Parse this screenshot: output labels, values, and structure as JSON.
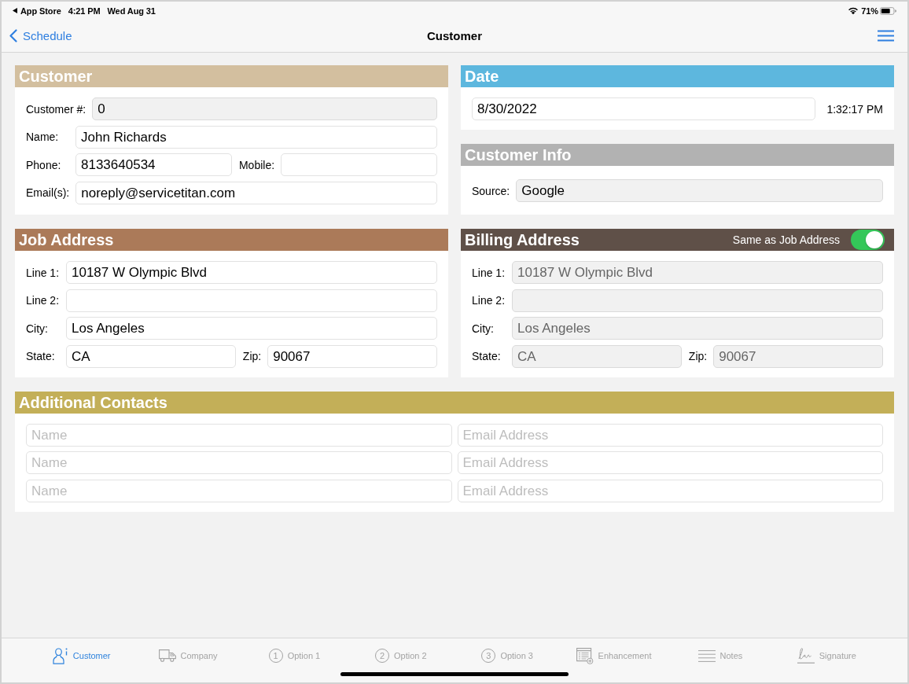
{
  "status_bar": {
    "back_app": "App Store",
    "time": "4:21 PM",
    "date": "Wed Aug 31",
    "battery": "71%"
  },
  "nav_bar": {
    "back": "Schedule",
    "title": "Customer"
  },
  "customer": {
    "title": "Customer",
    "rows": [
      [
        {
          "label": "Customer #:",
          "value": "0",
          "readonly": true
        }
      ],
      [
        {
          "label": "Name:",
          "value": "John Richards",
          "readonly": false
        }
      ],
      [
        {
          "label": "Phone:",
          "value": "8133640534",
          "readonly": false
        },
        {
          "label": "Mobile:",
          "readonly": false
        }
      ],
      [
        {
          "label": "Email(s):",
          "value": "noreply@servicetitan.com",
          "readonly": false
        }
      ]
    ]
  },
  "date": {
    "title": "Date",
    "value": "8/30/2022",
    "time": "1:32:17 PM"
  },
  "customer_info": {
    "title": "Customer Info",
    "rows": [
      [
        {
          "label": "Source:",
          "value": "Google",
          "readonly": true
        }
      ]
    ]
  },
  "job_address": {
    "title": "Job Address",
    "rows": [
      [
        {
          "label": "Line 1:",
          "value": "10187 W Olympic Blvd",
          "readonly": false
        }
      ],
      [
        {
          "label": "Line 2:",
          "readonly": false
        }
      ],
      [
        {
          "label": "City:",
          "value": "Los Angeles",
          "readonly": false
        }
      ],
      [
        {
          "label": "State:",
          "value": "CA",
          "readonly": false
        },
        {
          "label": "Zip:",
          "value": "90067",
          "readonly": false
        }
      ]
    ]
  },
  "billing_address": {
    "title": "Billing Address",
    "toggle": {
      "label": "Same as Job Address",
      "on": true
    },
    "rows": [
      [
        {
          "label": "Line 1:",
          "value": "10187 W Olympic Blvd",
          "readonly": true
        }
      ],
      [
        {
          "label": "Line 2:",
          "readonly": true
        }
      ],
      [
        {
          "label": "City:",
          "value": "Los Angeles",
          "readonly": true
        }
      ],
      [
        {
          "label": "State:",
          "value": "CA",
          "readonly": true
        },
        {
          "label": "Zip:",
          "value": "90067",
          "readonly": true
        }
      ]
    ]
  },
  "additional_contacts": {
    "title": "Additional Contacts",
    "rows": [
      [
        {
          "placeholder": "Name"
        },
        {
          "placeholder": "Email Address"
        }
      ],
      [
        {
          "placeholder": "Name"
        },
        {
          "placeholder": "Email Address"
        }
      ],
      [
        {
          "placeholder": "Name"
        },
        {
          "placeholder": "Email Address"
        }
      ]
    ]
  },
  "tab_bar": [
    {
      "label": "Customer",
      "kind": "person",
      "selected": true
    },
    {
      "label": "Company",
      "kind": "truck",
      "selected": false
    },
    {
      "label": "Option 1",
      "kind": "number",
      "number": "1",
      "selected": false
    },
    {
      "label": "Option 2",
      "kind": "number",
      "number": "2",
      "selected": false
    },
    {
      "label": "Option 3",
      "kind": "number",
      "number": "3",
      "selected": false
    },
    {
      "label": "Enhancement",
      "kind": "document",
      "selected": false
    },
    {
      "label": "Notes",
      "kind": "lines",
      "selected": false
    },
    {
      "label": "Signature",
      "kind": "signature",
      "selected": false
    }
  ]
}
